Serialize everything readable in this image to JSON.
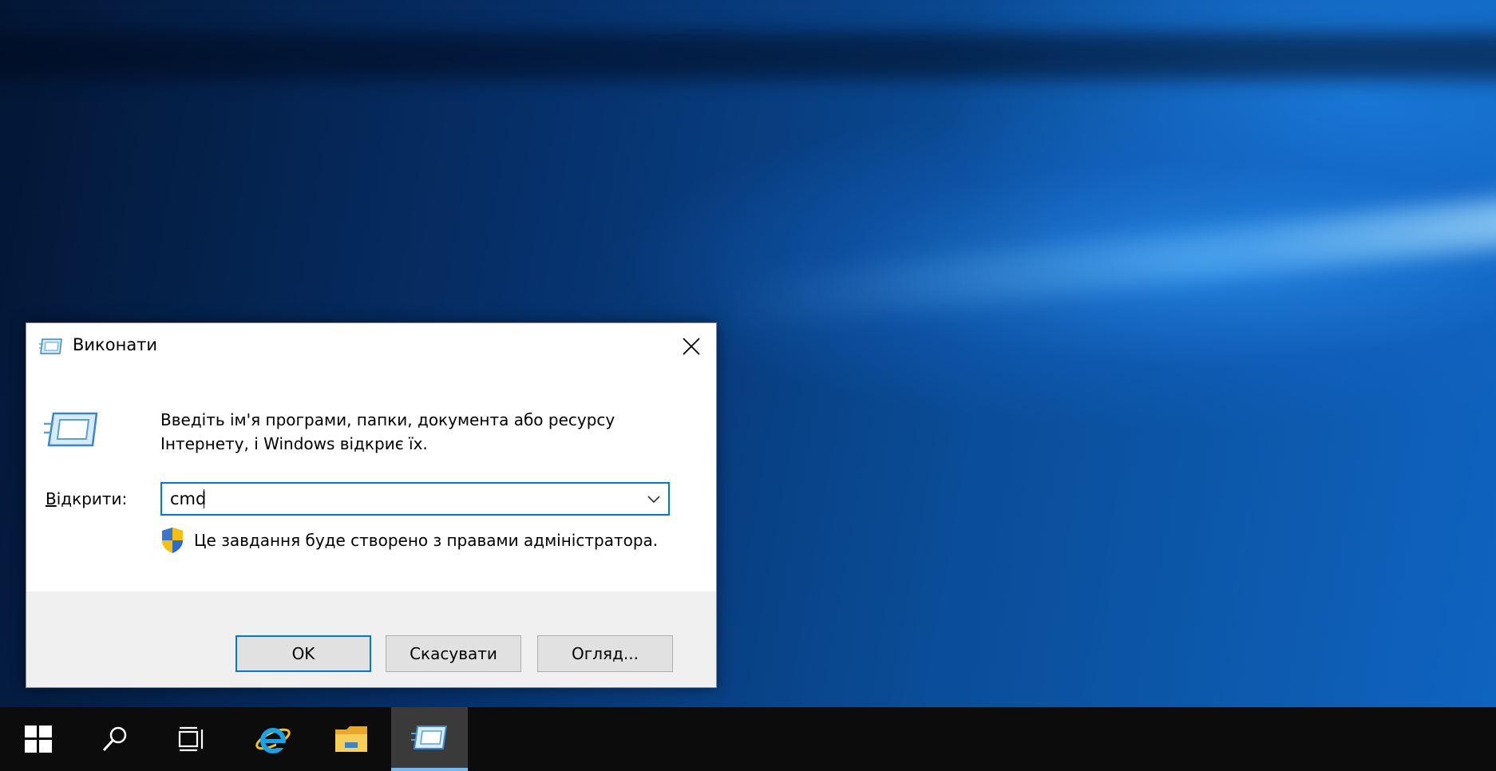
{
  "dialog": {
    "title": "Виконати",
    "description": "Введіть ім'я програми, папки, документа або ресурсу Інтернету, і Windows відкриє їх.",
    "open_label_mnemonic": "В",
    "open_label_rest": "ідкрити:",
    "input_value": "cmd",
    "admin_note": "Це завдання буде створено з правами адміністратора.",
    "ok_label": "OK",
    "cancel_label": "Скасувати",
    "browse_label": "Огляд..."
  },
  "taskbar": {
    "items": [
      "start-button",
      "search",
      "task-view",
      "internet-explorer",
      "file-explorer",
      "run-dialog"
    ],
    "active_item": "run-dialog"
  },
  "colors": {
    "accent": "#0078d7",
    "taskbar": "#0c0c0c",
    "footer": "#f0f0f0"
  }
}
